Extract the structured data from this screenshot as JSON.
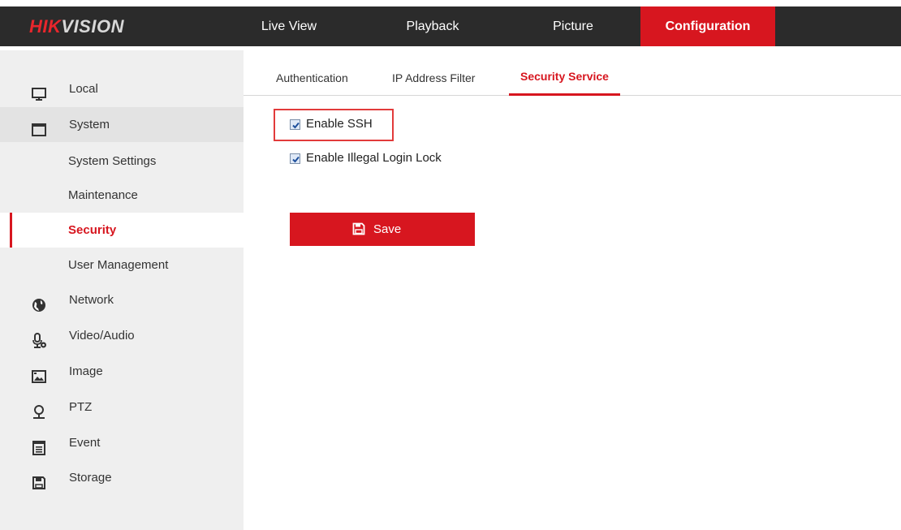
{
  "brand": {
    "logo_red": "HIK",
    "logo_white": "VISION"
  },
  "nav": {
    "items": [
      {
        "label": "Live View"
      },
      {
        "label": "Playback"
      },
      {
        "label": "Picture"
      },
      {
        "label": "Configuration",
        "active": true
      }
    ]
  },
  "sidebar": {
    "items": [
      {
        "label": "Local",
        "icon": "monitor-icon"
      },
      {
        "label": "System",
        "icon": "window-icon",
        "expanded": true
      },
      {
        "label": "System Settings",
        "sub": true
      },
      {
        "label": "Maintenance",
        "sub": true
      },
      {
        "label": "Security",
        "sub": true,
        "current": true
      },
      {
        "label": "User Management",
        "sub": true
      },
      {
        "label": "Network",
        "icon": "globe-icon"
      },
      {
        "label": "Video/Audio",
        "icon": "microphone-icon"
      },
      {
        "label": "Image",
        "icon": "image-icon"
      },
      {
        "label": "PTZ",
        "icon": "ptz-camera-icon"
      },
      {
        "label": "Event",
        "icon": "event-list-icon"
      },
      {
        "label": "Storage",
        "icon": "floppy-disk-icon"
      }
    ]
  },
  "tabs": [
    {
      "label": "Authentication"
    },
    {
      "label": "IP Address Filter"
    },
    {
      "label": "Security Service",
      "active": true
    }
  ],
  "form": {
    "enable_ssh": {
      "label": "Enable SSH",
      "checked": true
    },
    "enable_illegal_login_lock": {
      "label": "Enable Illegal Login Lock",
      "checked": true
    },
    "save_label": "Save"
  },
  "colors": {
    "accent": "#d7161f",
    "topbar": "#2b2b2b",
    "sidebar": "#efefef",
    "highlight": "#e23b3b"
  }
}
